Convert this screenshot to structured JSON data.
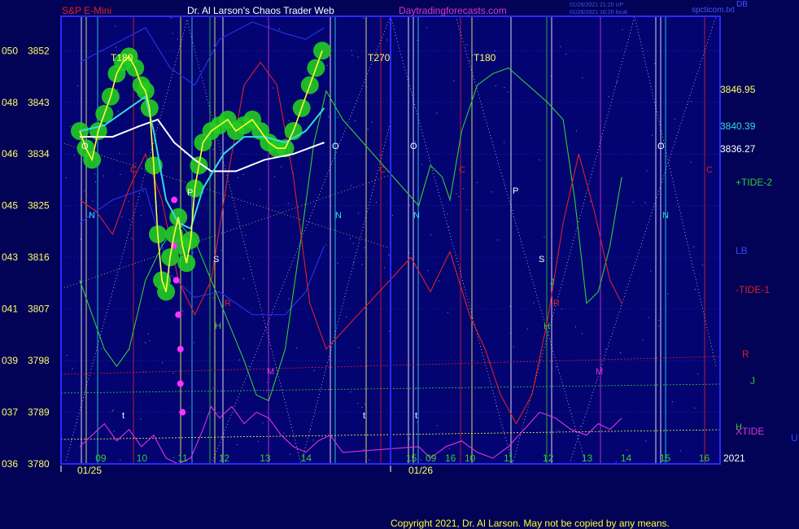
{
  "header": {
    "symbol": "S&P E-Mini",
    "title": "Dr. Al Larson's Chaos Trader Web",
    "site": "Daytradingforecasts.com",
    "stamp1": "01/26/2021 21:20 UP",
    "stamp2": "01/26/2021 16:20 local",
    "corner": "spcticom.txt",
    "corner_code": "DB"
  },
  "copyright": "Copyright 2021, Dr. Al Larson. May not be copied by any means.",
  "colors": {
    "background": "#020256",
    "plot_bg": "#030372",
    "frame": "#2a2aff",
    "price": "#ffff33",
    "glow": "#22cc22",
    "ma_fast": "#33dddd",
    "ma_slow": "#ffffff",
    "tide2": "#33cc33",
    "tide1": "#dd2222",
    "lb": "#2233dd",
    "xtide": "#dd33dd"
  },
  "chart_data": {
    "type": "line",
    "y_ticks": [
      {
        "left": "050",
        "price": "3852"
      },
      {
        "left": "048",
        "price": "3843"
      },
      {
        "left": "046",
        "price": "3834"
      },
      {
        "left": "045",
        "price": "3825"
      },
      {
        "left": "043",
        "price": "3816"
      },
      {
        "left": "041",
        "price": "3807"
      },
      {
        "left": "039",
        "price": "3798"
      },
      {
        "left": "037",
        "price": "3789"
      },
      {
        "left": "036",
        "price": "3780"
      }
    ],
    "ylim": [
      3780,
      3858
    ],
    "x_ticks": [
      "09",
      "10",
      "11",
      "12",
      "13",
      "14",
      "15",
      "16",
      "09",
      "10",
      "11",
      "12",
      "13",
      "14",
      "15",
      "16"
    ],
    "date_labels": [
      "01/25",
      "01/26"
    ],
    "year_label": "2021",
    "right_values": [
      "3846.95",
      "3840.39",
      "3836.27"
    ],
    "legend": [
      "+TIDE-2",
      "LB",
      "-TIDE-1",
      "R",
      "J",
      "H",
      "XTIDE",
      "U"
    ],
    "cycle_labels": [
      "T180",
      "T270",
      "T180"
    ],
    "markers": [
      "N",
      "C",
      "P",
      "S",
      "R",
      "H",
      "M",
      "O",
      "J",
      "t"
    ],
    "price_series": [
      [
        0,
        3838
      ],
      [
        0.15,
        3835
      ],
      [
        0.3,
        3833
      ],
      [
        0.45,
        3838
      ],
      [
        0.6,
        3841
      ],
      [
        0.75,
        3844
      ],
      [
        0.9,
        3848
      ],
      [
        1.05,
        3850
      ],
      [
        1.2,
        3851
      ],
      [
        1.35,
        3849
      ],
      [
        1.5,
        3846
      ],
      [
        1.6,
        3845
      ],
      [
        1.7,
        3842
      ],
      [
        1.8,
        3832
      ],
      [
        1.9,
        3820
      ],
      [
        2.0,
        3812
      ],
      [
        2.1,
        3810
      ],
      [
        2.2,
        3816
      ],
      [
        2.3,
        3820
      ],
      [
        2.4,
        3823
      ],
      [
        2.5,
        3818
      ],
      [
        2.6,
        3815
      ],
      [
        2.7,
        3819
      ],
      [
        2.8,
        3828
      ],
      [
        2.9,
        3832
      ],
      [
        3.0,
        3836
      ],
      [
        3.2,
        3838
      ],
      [
        3.4,
        3839
      ],
      [
        3.6,
        3840
      ],
      [
        3.8,
        3838
      ],
      [
        4.0,
        3839
      ],
      [
        4.2,
        3840
      ],
      [
        4.4,
        3838
      ],
      [
        4.6,
        3836
      ],
      [
        4.8,
        3835
      ],
      [
        5.0,
        3835
      ],
      [
        5.2,
        3838
      ],
      [
        5.4,
        3842
      ],
      [
        5.6,
        3846
      ],
      [
        5.75,
        3849
      ],
      [
        5.9,
        3852
      ]
    ],
    "ma_fast_series": [
      [
        0,
        3838
      ],
      [
        0.6,
        3839
      ],
      [
        1.2,
        3842
      ],
      [
        1.6,
        3844
      ],
      [
        1.8,
        3838
      ],
      [
        2.1,
        3826
      ],
      [
        2.4,
        3822
      ],
      [
        2.7,
        3821
      ],
      [
        3.0,
        3828
      ],
      [
        3.5,
        3834
      ],
      [
        4.0,
        3837
      ],
      [
        4.5,
        3837
      ],
      [
        5.0,
        3836
      ],
      [
        5.5,
        3838
      ],
      [
        5.95,
        3842
      ]
    ],
    "ma_slow_series": [
      [
        0,
        3837
      ],
      [
        0.8,
        3837
      ],
      [
        1.5,
        3839
      ],
      [
        1.9,
        3840
      ],
      [
        2.3,
        3836
      ],
      [
        2.8,
        3833
      ],
      [
        3.2,
        3831
      ],
      [
        3.8,
        3831
      ],
      [
        4.5,
        3833
      ],
      [
        5.2,
        3834
      ],
      [
        5.95,
        3836
      ]
    ],
    "tide2_series": [
      [
        0,
        3812
      ],
      [
        0.3,
        3806
      ],
      [
        0.6,
        3800
      ],
      [
        0.9,
        3797
      ],
      [
        1.2,
        3800
      ],
      [
        1.6,
        3812
      ],
      [
        2.0,
        3818
      ],
      [
        2.4,
        3822
      ],
      [
        2.8,
        3819
      ],
      [
        3.2,
        3812
      ],
      [
        3.6,
        3805
      ],
      [
        4.0,
        3798
      ],
      [
        4.3,
        3792
      ],
      [
        4.6,
        3791
      ],
      [
        5.0,
        3800
      ],
      [
        5.4,
        3820
      ],
      [
        5.7,
        3836
      ],
      [
        6.0,
        3845
      ],
      [
        6.4,
        3840
      ],
      [
        6.7,
        3825
      ],
      [
        7.0,
        3832
      ],
      [
        7.3,
        3830
      ],
      [
        7.5,
        3826
      ],
      [
        7.8,
        3838
      ],
      [
        8.2,
        3846
      ],
      [
        8.6,
        3848
      ],
      [
        9.0,
        3849
      ],
      [
        9.5,
        3846
      ],
      [
        10.0,
        3843
      ],
      [
        10.4,
        3840
      ],
      [
        10.7,
        3826
      ],
      [
        11.0,
        3808
      ],
      [
        11.3,
        3810
      ],
      [
        11.6,
        3818
      ],
      [
        11.9,
        3830
      ]
    ],
    "tide1_series": [
      [
        0,
        3826
      ],
      [
        0.4,
        3824
      ],
      [
        0.8,
        3820
      ],
      [
        1.2,
        3828
      ],
      [
        1.6,
        3834
      ],
      [
        2.0,
        3826
      ],
      [
        2.4,
        3812
      ],
      [
        2.8,
        3806
      ],
      [
        3.2,
        3812
      ],
      [
        3.6,
        3830
      ],
      [
        4.0,
        3846
      ],
      [
        4.4,
        3850
      ],
      [
        4.8,
        3846
      ],
      [
        5.2,
        3830
      ],
      [
        5.6,
        3808
      ],
      [
        6.0,
        3800
      ],
      [
        6.5,
        3816
      ],
      [
        7.0,
        3810
      ],
      [
        7.5,
        3817
      ],
      [
        8.0,
        3806
      ],
      [
        8.4,
        3800
      ],
      [
        8.8,
        3792
      ],
      [
        9.2,
        3787
      ],
      [
        9.6,
        3792
      ],
      [
        10.0,
        3805
      ],
      [
        10.4,
        3822
      ],
      [
        10.8,
        3834
      ],
      [
        11.2,
        3824
      ],
      [
        11.6,
        3812
      ],
      [
        11.9,
        3808
      ]
    ],
    "band_upper": [
      [
        0,
        3850
      ],
      [
        0.8,
        3853
      ],
      [
        1.6,
        3856
      ],
      [
        2.2,
        3849
      ],
      [
        2.8,
        3846
      ],
      [
        3.4,
        3854
      ],
      [
        4.2,
        3857
      ],
      [
        5.0,
        3855
      ],
      [
        5.5,
        3854
      ],
      [
        5.95,
        3856
      ]
    ],
    "band_lower": [
      [
        0,
        3822
      ],
      [
        0.8,
        3826
      ],
      [
        1.6,
        3828
      ],
      [
        2.2,
        3813
      ],
      [
        2.8,
        3809
      ],
      [
        3.4,
        3810
      ],
      [
        4.2,
        3806
      ],
      [
        5.0,
        3806
      ],
      [
        5.5,
        3810
      ],
      [
        5.95,
        3818
      ]
    ],
    "xtide_series": [
      [
        0,
        3783
      ],
      [
        0.3,
        3785
      ],
      [
        0.6,
        3787
      ],
      [
        0.9,
        3784
      ],
      [
        1.2,
        3786
      ],
      [
        1.5,
        3783
      ],
      [
        1.8,
        3785
      ],
      [
        2.1,
        3781
      ],
      [
        2.4,
        3780
      ],
      [
        2.7,
        3781
      ],
      [
        3.0,
        3786
      ],
      [
        3.2,
        3790
      ],
      [
        3.4,
        3788
      ],
      [
        3.7,
        3790
      ],
      [
        4.0,
        3787
      ],
      [
        4.3,
        3789
      ],
      [
        4.6,
        3788
      ],
      [
        4.9,
        3785
      ],
      [
        5.2,
        3783
      ],
      [
        5.5,
        3782
      ],
      [
        5.8,
        3784
      ],
      [
        6.1,
        3785
      ],
      [
        6.4,
        3782
      ],
      [
        6.7,
        3783
      ],
      [
        7.0,
        3781
      ],
      [
        7.4,
        3783
      ],
      [
        7.8,
        3784
      ],
      [
        8.2,
        3782
      ],
      [
        8.6,
        3781
      ],
      [
        9.0,
        3783
      ],
      [
        9.4,
        3786
      ],
      [
        9.8,
        3789
      ],
      [
        10.2,
        3788
      ],
      [
        10.6,
        3786
      ],
      [
        11.0,
        3785
      ],
      [
        11.3,
        3787
      ],
      [
        11.6,
        3786
      ],
      [
        11.9,
        3788
      ]
    ]
  }
}
